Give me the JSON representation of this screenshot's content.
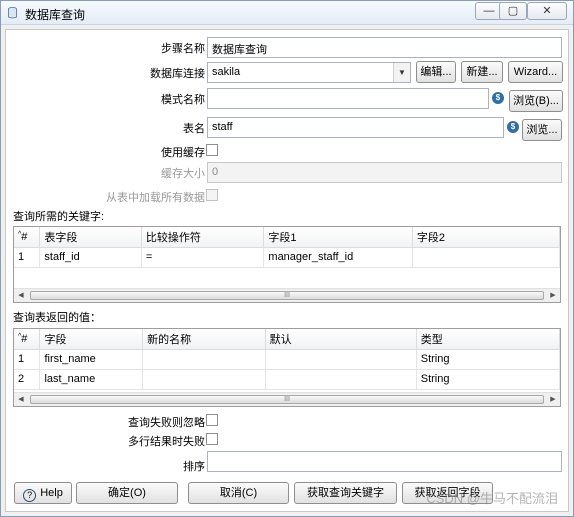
{
  "window": {
    "title": "数据库查询",
    "controls": [
      "—",
      "▢",
      "✕"
    ]
  },
  "form": {
    "step_name_label": "步骤名称",
    "step_name_value": "数据库查询",
    "connection_label": "数据库连接",
    "connection_value": "sakila",
    "edit_button": "编辑...",
    "new_button": "新建...",
    "wizard_button": "Wizard...",
    "schema_label": "模式名称",
    "schema_value": "",
    "browse_schema_button": "浏览(B)...",
    "table_label": "表名",
    "table_value": "staff",
    "browse_table_button": "浏览...",
    "use_cache_label": "使用缓存",
    "cache_size_label": "缓存大小",
    "cache_size_value": "0",
    "load_all_label": "从表中加载所有数据"
  },
  "keys": {
    "section_label": "查询所需的关键字:",
    "columns": [
      "#",
      "表字段",
      "比较操作符",
      "字段1",
      "字段2"
    ],
    "rows": [
      [
        "1",
        "staff_id",
        "=",
        "manager_staff_id",
        ""
      ]
    ]
  },
  "returns": {
    "section_label": "查询表返回的值：",
    "columns": [
      "#",
      "字段",
      "新的名称",
      "默认",
      "类型"
    ],
    "rows": [
      [
        "1",
        "first_name",
        "",
        "",
        "String"
      ],
      [
        "2",
        "last_name",
        "",
        "",
        "String"
      ]
    ]
  },
  "options": {
    "fail_ignore_label": "查询失败则忽略",
    "multi_fail_label": "多行结果时失败",
    "order_label": "排序",
    "order_value": ""
  },
  "buttons": {
    "help": "Help",
    "ok": "确定(O)",
    "cancel": "取消(C)",
    "get_keys": "获取查询关键字",
    "get_fields": "获取返回字段"
  },
  "icons": {
    "help": "?",
    "variable": "$",
    "scroll_left": "◀",
    "scroll_right": "▶",
    "scroll_grip": "III",
    "dropdown": "▼",
    "sort": "^"
  },
  "watermark": "CSDN @牛马不配流泪"
}
